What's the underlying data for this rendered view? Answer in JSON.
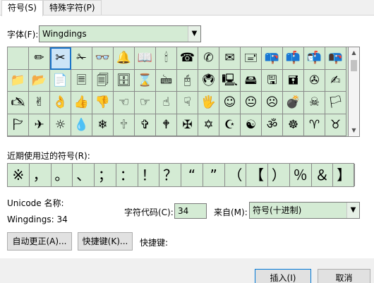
{
  "tabs": [
    {
      "label": "符号(S)",
      "active": true
    },
    {
      "label": "特殊字符(P)",
      "active": false
    }
  ],
  "font": {
    "label": "字体(F):",
    "value": "Wingdings"
  },
  "symbols": [
    "",
    "✏",
    "✂",
    "✁",
    "👓",
    "🔔",
    "📖",
    "🕯",
    "☎",
    "✆",
    "✉",
    "🖃",
    "📪",
    "📫",
    "📬",
    "📭",
    "📁",
    "📂",
    "📄",
    "🗏",
    "🗐",
    "🗄",
    "⌛",
    "🖮",
    "🖰",
    "🖲",
    "🖳",
    "🖴",
    "🖫",
    "🖬",
    "✇",
    "✍",
    "🖎",
    "✌",
    "👌",
    "👍",
    "👎",
    "☜",
    "☞",
    "☝",
    "☟",
    "🖐",
    "☺",
    "😐",
    "☹",
    "💣",
    "☠",
    "🏳",
    "🏱",
    "✈",
    "☼",
    "💧",
    "❄",
    "🕆",
    "✞",
    "🕈",
    "✠",
    "✡",
    "☪",
    "☯",
    "ॐ",
    "☸",
    "♈",
    "♉"
  ],
  "recent": {
    "label": "近期使用过的符号(R):",
    "items": [
      "※",
      "，",
      "。",
      "、",
      "；",
      "：",
      "！",
      "？",
      "“",
      "”",
      "（",
      "【",
      "）",
      "％",
      "＆",
      "】"
    ]
  },
  "unicode_name_label": "Unicode 名称:",
  "char_info": "Wingdings: 34",
  "char_code": {
    "label": "字符代码(C):",
    "value": "34"
  },
  "from": {
    "label": "来自(M):",
    "value": "符号(十进制)"
  },
  "buttons": {
    "autocorrect": "自动更正(A)...",
    "shortcut_key": "快捷键(K)...",
    "shortcut_label": "快捷键:",
    "insert": "插入(I)",
    "cancel": "取消"
  },
  "colors": {
    "accent": "#0078d7",
    "grid_bg": "#d4ebd4"
  }
}
